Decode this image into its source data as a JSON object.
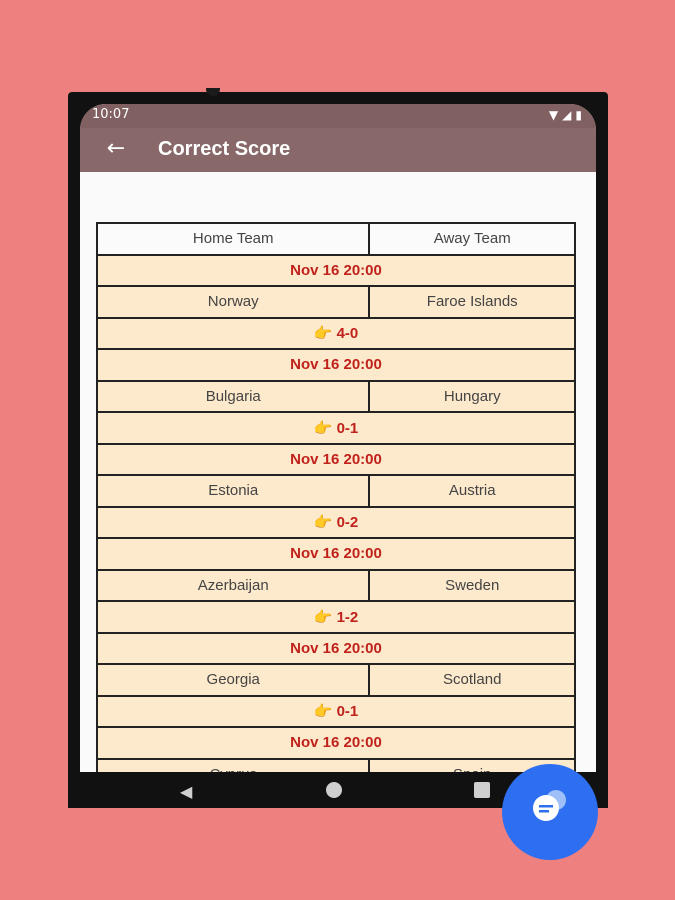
{
  "status": {
    "time": "10:07",
    "wifi_icon": "wifi-icon",
    "signal_icon": "signal-icon",
    "battery_icon": "battery-icon"
  },
  "appbar": {
    "back_icon": "arrow-left-icon",
    "title": "Correct Score"
  },
  "table": {
    "home_header": "Home Team",
    "away_header": "Away Team",
    "matches": [
      {
        "date": "Nov 16 20:00",
        "home": "Norway",
        "away": "Faroe Islands",
        "score": "👉 4-0"
      },
      {
        "date": "Nov 16 20:00",
        "home": "Bulgaria",
        "away": "Hungary",
        "score": "👉 0-1"
      },
      {
        "date": "Nov 16 20:00",
        "home": "Estonia",
        "away": "Austria",
        "score": "👉 0-2"
      },
      {
        "date": "Nov 16 20:00",
        "home": "Azerbaijan",
        "away": "Sweden",
        "score": "👉 1-2"
      },
      {
        "date": "Nov 16 20:00",
        "home": "Georgia",
        "away": "Scotland",
        "score": "👉 0-1"
      },
      {
        "date": "Nov 16 20:00",
        "home": "Cyprus",
        "away": "Spain",
        "score": ""
      }
    ]
  },
  "navbar": {
    "back_icon": "triangle-back-icon",
    "home_icon": "circle-home-icon",
    "recent_icon": "square-recent-icon"
  },
  "fab": {
    "icon": "chat-bubble-icon",
    "color": "#2d6ff0"
  },
  "colors": {
    "background": "#ef8080",
    "appbar": "#886868",
    "row": "#fde9cc",
    "accent": "#c0211b"
  }
}
